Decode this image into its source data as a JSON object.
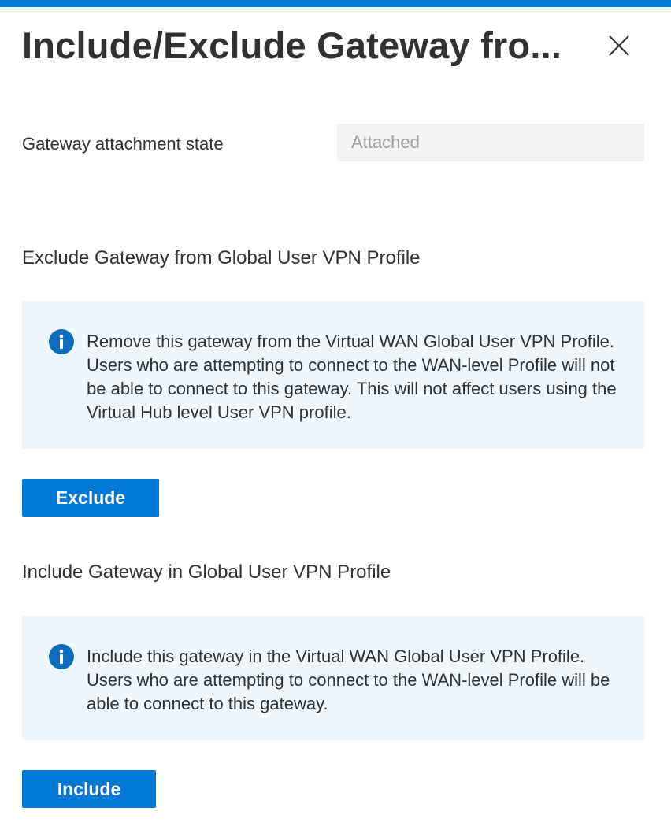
{
  "panel": {
    "title": "Include/Exclude Gateway fro...",
    "close_icon": "close-icon"
  },
  "attachment": {
    "label": "Gateway attachment state",
    "value": "Attached"
  },
  "exclude_section": {
    "heading": "Exclude Gateway from Global User VPN Profile",
    "info_icon": "info-icon",
    "info_text": "Remove this gateway from the Virtual WAN Global User VPN Profile. Users who are attempting to connect to the WAN-level Profile will not be able to connect to this gateway. This will not affect users using the Virtual Hub level User VPN profile.",
    "button_label": "Exclude"
  },
  "include_section": {
    "heading": "Include Gateway in Global User VPN Profile",
    "info_icon": "info-icon",
    "info_text": "Include this gateway in the Virtual WAN Global User VPN Profile. Users who are attempting to connect to the WAN-level Profile will be able to connect to this gateway.",
    "button_label": "Include"
  },
  "colors": {
    "accent": "#0078d4",
    "info_background": "#eff6fc",
    "disabled_field": "#f3f2f1"
  }
}
